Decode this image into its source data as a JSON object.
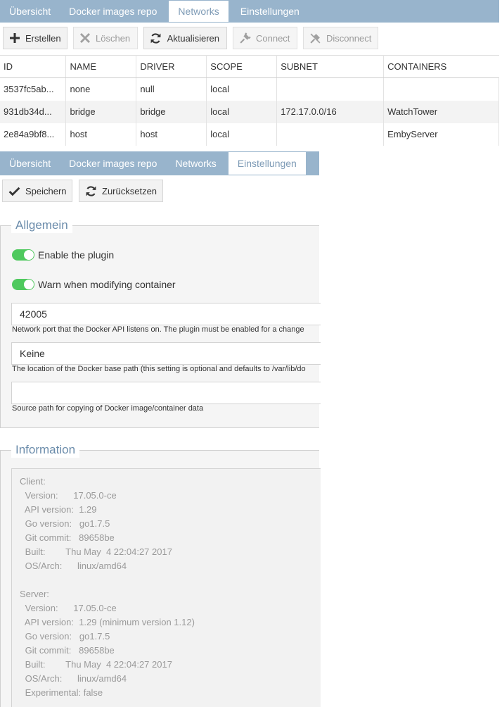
{
  "tabs_top": [
    "Übersicht",
    "Docker images repo",
    "Networks",
    "Einstellungen"
  ],
  "toolbar": {
    "create": "Erstellen",
    "delete": "Löschen",
    "refresh": "Aktualisieren",
    "connect": "Connect",
    "disconnect": "Disconnect"
  },
  "table": {
    "headers": [
      "ID",
      "NAME",
      "DRIVER",
      "SCOPE",
      "SUBNET",
      "CONTAINERS"
    ],
    "rows": [
      [
        "3537fc5ab...",
        "none",
        "null",
        "local",
        "",
        ""
      ],
      [
        "931db34d...",
        "bridge",
        "bridge",
        "local",
        "172.17.0.0/16",
        "WatchTower"
      ],
      [
        "2e84a9bf8...",
        "host",
        "host",
        "local",
        "",
        "EmbyServer"
      ]
    ]
  },
  "tabs_bottom": [
    "Übersicht",
    "Docker images repo",
    "Networks",
    "Einstellungen"
  ],
  "settings_toolbar": {
    "save": "Speichern",
    "reset": "Zurücksetzen"
  },
  "general": {
    "legend": "Allgemein",
    "enable_plugin": "Enable the plugin",
    "warn_modify": "Warn when modifying container",
    "port_value": "42005",
    "port_hint": "Network port that the Docker API listens on. The plugin must be enabled for a change",
    "base_path_value": "Keine",
    "base_path_hint": "The location of the Docker base path (this setting is optional and defaults to /var/lib/do",
    "source_path_value": "",
    "source_path_hint": "Source path for copying of Docker image/container data"
  },
  "information": {
    "legend": "Information",
    "client_header": "Client:",
    "client": [
      " Version:      17.05.0-ce",
      " API version:  1.29",
      " Go version:   go1.7.5",
      " Git commit:   89658be",
      " Built:        Thu May  4 22:04:27 2017",
      " OS/Arch:      linux/amd64"
    ],
    "server_header": "Server:",
    "server": [
      " Version:      17.05.0-ce",
      " API version:  1.29 (minimum version 1.12)",
      " Go version:   go1.7.5",
      " Git commit:   89658be",
      " Built:        Thu May  4 22:04:27 2017",
      " OS/Arch:      linux/amd64",
      " Experimental: false"
    ]
  },
  "colors": {
    "tabbar": "#98b4cc",
    "active_tab_text": "#7e9bb6",
    "legend": "#6b8cab",
    "toggle_on": "#4fc95e"
  }
}
